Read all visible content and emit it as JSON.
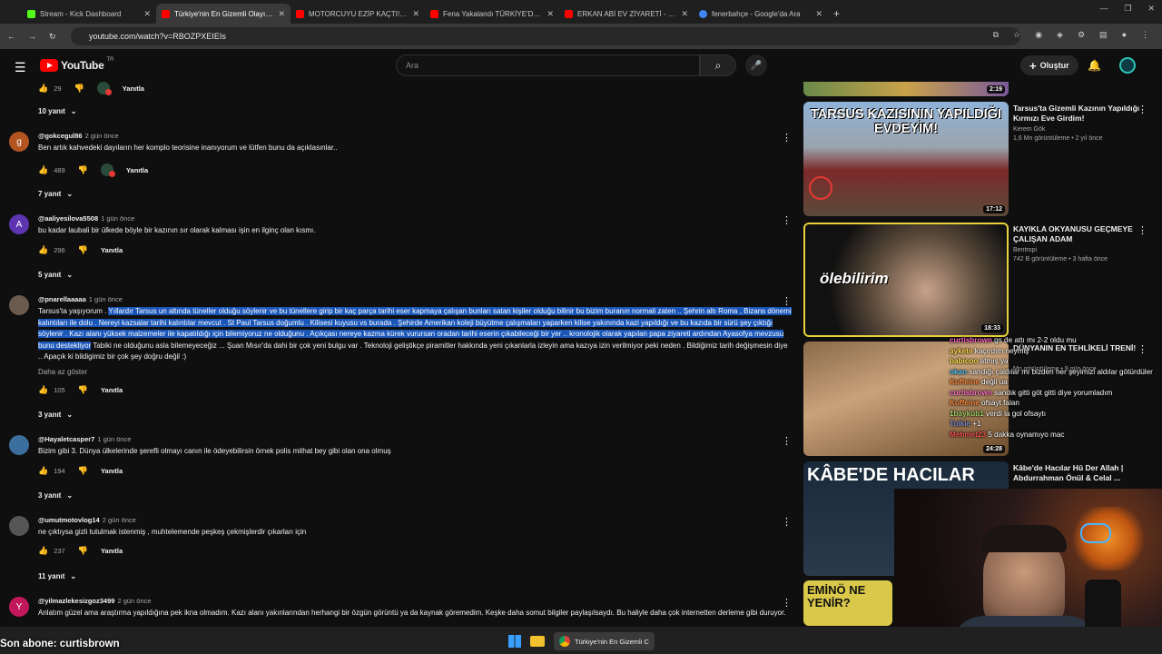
{
  "browser": {
    "tabs": [
      {
        "title": "Stream - Kick Dashboard",
        "color": "#53fc18",
        "active": false
      },
      {
        "title": "Türkiye'nin En Gizemli Olayı: Ta",
        "color": "#ff0000",
        "active": true
      },
      {
        "title": "MOTORCUYU EZİP KAÇTI! Türk",
        "color": "#ff0000",
        "active": false
      },
      {
        "title": "Fena Yakalandı TÜRKİYE'DE YA",
        "color": "#ff0000",
        "active": false
      },
      {
        "title": "ERKAN ABİ EV ZİYARETİ - YouT",
        "color": "#ff0000",
        "active": false
      },
      {
        "title": "fenerbahçe - Google'da Ara",
        "color": "#4285f4",
        "active": false
      }
    ],
    "new_tab": "+",
    "url": "youtube.com/watch?v=RBOZPXEIEIs"
  },
  "youtube": {
    "logo": "YouTube",
    "region": "TR",
    "search_placeholder": "Ara",
    "create_label": "Oluştur"
  },
  "comments": {
    "top_reply": {
      "likes": "29",
      "reply_label": "Yanıtla"
    },
    "items": [
      {
        "replies_above": "10 yanıt",
        "user": "@gokcegul86",
        "time": "2 gün önce",
        "avatar_letter": "g",
        "avatar_color": "#b35421",
        "text": "Ben artık kahvedeki dayıların her komplo teorisine inanıyorum ve lütfen bunu da açıklasınlar..",
        "likes": "489",
        "reply_label": "Yanıtla"
      },
      {
        "replies_above": "7 yanıt",
        "user": "@aaliyesilova5508",
        "time": "1 gün önce",
        "avatar_letter": "A",
        "avatar_color": "#5e35b1",
        "text": "bu kadar laubali bir ülkede böyle bir kazının sır olarak kalması işin en ilginç olan kısmı.",
        "likes": "296",
        "reply_label": "Yanıtla"
      },
      {
        "replies_above": "5 yanıt",
        "user": "@pnarellaaaaa",
        "time": "1 gün önce",
        "avatar_letter": "",
        "avatar_color": "#6b5b4e",
        "text_plain": "Tarsus'ta yaşıyorum . ",
        "text_highlight": "Yıllardır Tarsus un altında tüneller olduğu söylenir ve bu tünellere girip bir kaç parça tarihi eser kapmaya çalışan bunları satan kişiler olduğu bilinir bu bizim buranın normali zaten .. Şehrin altı Roma , Bizans dönemi kalıntıları ile dolu . Nereyi kazsalar tarihi kalıntılar mevcut . St Paul Tarsus doğumlu . Kilisesi kuyusu vs burada . Şehirde Amerikan koleji büyütme çalışmaları yaparken kilise yakınında kazi yapıldığı ve bu kazıda bir sürü şey çıktığı söylenir . Kazı alanı yüksek malzemeler ile kapatıldığı için bilemiyoruz ne olduğunu . Açıkçası nereye kazma kürek vurursan oradan tarihi eserin çıkabileceği bir yer .. kronolojik olarak yapılan papa ziyareti ardından Ayasofya mevzusu bunu destekliyor",
        "text_rest": " Tabiki ne olduğunu asla bilemeyeceğiz ... Şuan Mısır'da dahi bir çok yeni bulgu var . Teknoloji geliştikçe piramitler hakkında yeni çıkanlarla izleyin ama kazıya izin verilmiyor peki neden . Bildiğimiz tarih değişmesin diye ..  Apaçık ki bildigimiz bir çok şey doğru değil :)",
        "more_label": "Daha az göster",
        "likes": "105",
        "reply_label": "Yanıtla"
      },
      {
        "replies_above": "3 yanıt",
        "user": "@Hayaletcasper7",
        "time": "1 gün önce",
        "avatar_letter": "",
        "avatar_color": "#3c6e9e",
        "text": "Bizim gibi 3. Dünya ülkelerinde şerefli olmayı canın ile ödeyebilirsin örnek polis mithat bey gibi olan ona olmuş",
        "likes": "194",
        "reply_label": "Yanıtla"
      },
      {
        "replies_above": "3 yanıt",
        "user": "@umutmotovlog14",
        "time": "2 gün önce",
        "avatar_letter": "",
        "avatar_color": "#555555",
        "text": "ne çıktıysa gizli tutulmak istenmiş , muhtelemende peşkeş çekmişlerdir çıkarları için",
        "likes": "237",
        "reply_label": "Yanıtla"
      },
      {
        "replies_above": "11 yanıt",
        "user": "@yilmazlekesizgoz3499",
        "time": "2 gün önce",
        "avatar_letter": "Y",
        "avatar_color": "#c2185b",
        "text": "Anlatım güzel ama araştırma yapıldığına pek ikna olmadım. Kazı alanı yakınlarından herhangi bir özgün görüntü ya da kaynak göremedim. Keşke daha somut bilgiler paylaşılsaydı. Bu haliyle daha çok internetten derleme gibi duruyor.",
        "likes": "",
        "reply_label": "Yanıtla"
      }
    ]
  },
  "sidebar": {
    "top_duration": "2:19",
    "videos": [
      {
        "title": "Tarsus'ta Gizemli Kazının Yapıldığı Kırmızı Eve Girdim!",
        "channel": "Kerem Gök",
        "meta": "1,6 Mn görüntüleme • 2 yıl önce",
        "duration": "17:12",
        "thumb_text": "TARSUS KAZISININ YAPILDIĞI EVDEYİM!"
      },
      {
        "title": "KAYIKLA OKYANUSU GEÇMEYE ÇALIŞAN ADAM",
        "channel": "Bentropi",
        "meta": "742 B görüntüleme • 3 hafta önce",
        "duration": "18:33",
        "thumb_text": "ölebilirim"
      },
      {
        "title": "DÜNYANIN EN TEHLİKELİ TRENİ!",
        "channel": "",
        "meta": "Mn görüntüleme • 9 gün önce",
        "duration": "24:28",
        "thumb_text": ""
      },
      {
        "title": "Kâbe'de Hacılar Hû Der Allah | Abdurrahman Önül & Celal ...",
        "channel": "",
        "meta": "",
        "duration": "",
        "thumb_text": "KÂBE'DE HACILAR"
      },
      {
        "title": "",
        "channel": "",
        "meta": "",
        "duration": "",
        "thumb_text": "EMİNÖ NE YENİR?"
      }
    ]
  },
  "chat": [
    {
      "user": "curtisbrown",
      "color": "#ff6ec7",
      "msg": " gs de attı mı 2-2 oldu mu"
    },
    {
      "user": "aykete",
      "color": "#ffd54f",
      "msg": " kaçırdım neymiş"
    },
    {
      "user": "babicoo",
      "color": "#ffe14d",
      "msg": " atmış ya"
    },
    {
      "user": "okan",
      "color": "#4fc3f7",
      "msg": " sandığı çaldılar mı bizden her şeyimizi aldılar götürdüler"
    },
    {
      "user": "Koffeine",
      "color": "#ff8a3d",
      "msg": " değil ua"
    },
    {
      "user": "curtisbrown",
      "color": "#ff6ec7",
      "msg": " sandık gitti göt gitti diye yorumladım"
    },
    {
      "user": "Koffeine",
      "color": "#ff8a3d",
      "msg": " ofsayt falan"
    },
    {
      "user": "1baykub1",
      "color": "#9ccc65",
      "msg": " verdi la gol ofsaytı"
    },
    {
      "user": "Tolkie",
      "color": "#7986cb",
      "msg": " +1"
    },
    {
      "user": "Mehmet23",
      "color": "#ef5350",
      "msg": " 5 dakka oynamıyo mac"
    }
  ],
  "overlay": {
    "last_sub": "Son abone: curtisbrown"
  },
  "taskbar": {
    "active_app": "Türkiye'nin En Gizemli C"
  }
}
